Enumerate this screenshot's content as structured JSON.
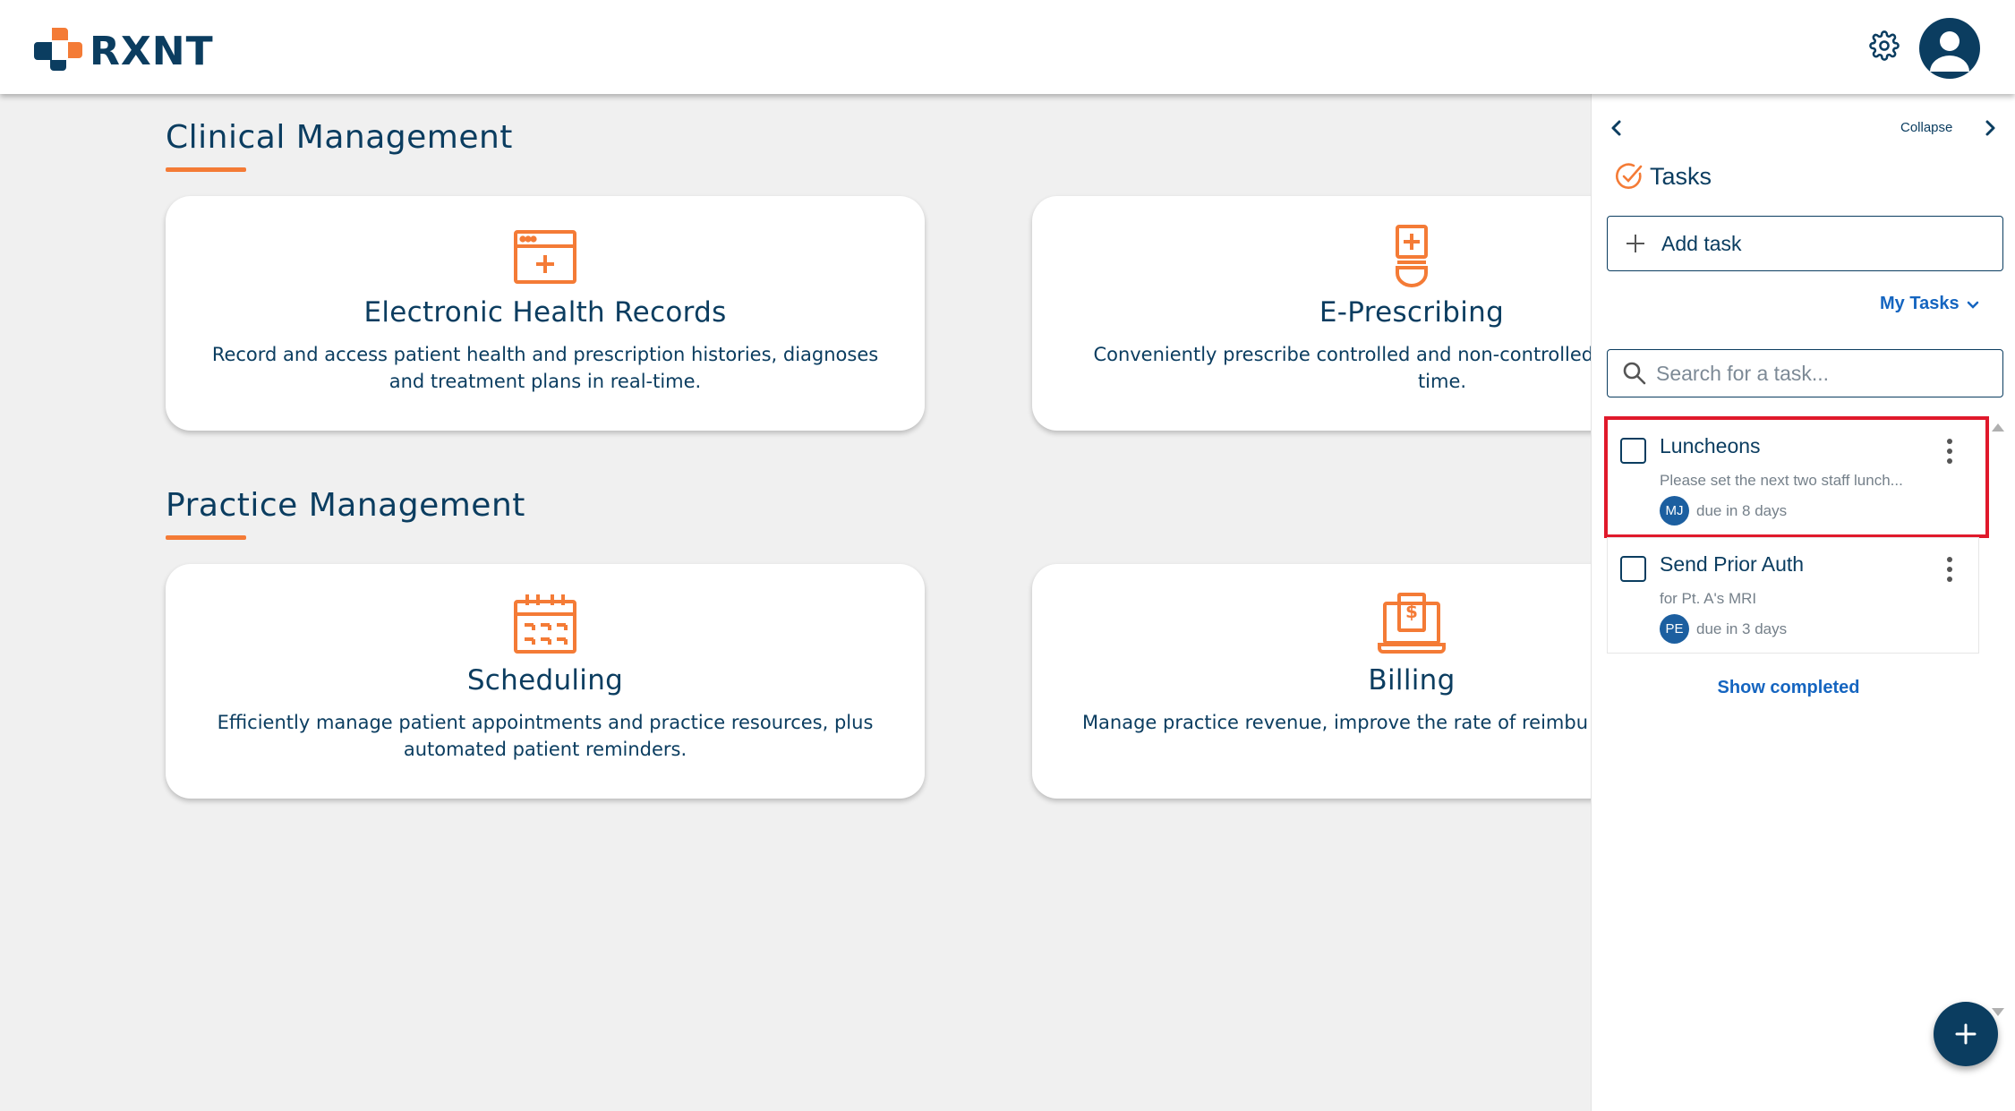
{
  "header": {
    "logo_text": "RXNT",
    "icons": {
      "settings": "gear-icon",
      "profile": "user-avatar-icon"
    }
  },
  "colors": {
    "brand_navy": "#0b3d60",
    "brand_orange": "#f47b36",
    "link_blue": "#1565c0",
    "highlight_red": "#e0192b"
  },
  "sections": [
    {
      "title": "Clinical Management",
      "cards": [
        {
          "title": "Electronic Health Records",
          "description": "Record and access patient health and prescription histories, diagnoses and treatment plans in real-time.",
          "icon": "health-record-icon"
        },
        {
          "title": "E-Prescribing",
          "description": "Conveniently prescribe controlled and non-controlled su anywhere, at any time.",
          "icon": "prescription-icon"
        }
      ]
    },
    {
      "title": "Practice Management",
      "cards": [
        {
          "title": "Scheduling",
          "description": "Efficiently manage patient appointments and practice resources, plus automated patient reminders.",
          "icon": "calendar-icon"
        },
        {
          "title": "Billing",
          "description": "Manage practice revenue, improve the rate of reimbu maximize profitability.",
          "icon": "billing-laptop-icon"
        }
      ]
    }
  ],
  "panel": {
    "collapse_label": "Collapse",
    "title": "Tasks",
    "add_task_label": "Add task",
    "filter_label": "My Tasks",
    "search_placeholder": "Search for a task...",
    "tasks": [
      {
        "title": "Luncheons",
        "description": "Please set the next two staff lunch...",
        "assignee_initials": "MJ",
        "due": "due in 8 days",
        "highlighted": true
      },
      {
        "title": "Send Prior Auth",
        "description": "for Pt. A's MRI",
        "assignee_initials": "PE",
        "due": "due in 3 days",
        "highlighted": false
      }
    ],
    "show_completed_label": "Show completed"
  }
}
